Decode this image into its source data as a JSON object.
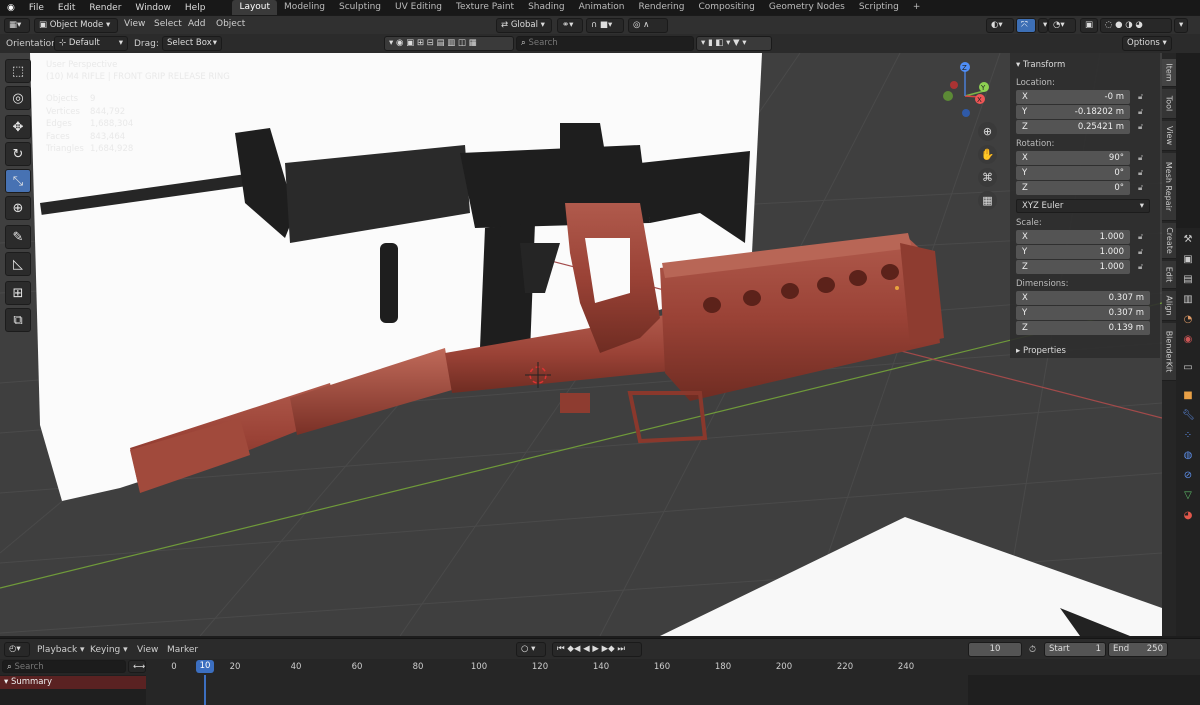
{
  "menu": [
    "File",
    "Edit",
    "Render",
    "Window",
    "Help"
  ],
  "workspaces": [
    "Layout",
    "Modeling",
    "Sculpting",
    "UV Editing",
    "Texture Paint",
    "Shading",
    "Animation",
    "Rendering",
    "Compositing",
    "Geometry Nodes",
    "Scripting"
  ],
  "header": {
    "mode": "Object Mode",
    "view": "View",
    "select": "Select",
    "add": "Add",
    "object": "Object",
    "transform_orientation": "Global",
    "options": "Options"
  },
  "tool_options": {
    "orientation_label": "Orientation:",
    "orientation_value": "Default",
    "drag_label": "Drag:",
    "drag_value": "Select Box",
    "search_placeholder": "Search"
  },
  "viewport": {
    "perspective": "User Perspective",
    "object_info": "(10) M4 RIFLE | FRONT GRIP RELEASE RING",
    "stats": [
      {
        "k": "Objects",
        "v": "9"
      },
      {
        "k": "Vertices",
        "v": "844,792"
      },
      {
        "k": "Edges",
        "v": "1,688,304"
      },
      {
        "k": "Faces",
        "v": "843,464"
      },
      {
        "k": "Triangles",
        "v": "1,684,928"
      }
    ],
    "gizmo": {
      "x": "X",
      "y": "Y",
      "z": "Z"
    }
  },
  "npanel": {
    "transform": "Transform",
    "location_label": "Location:",
    "location": [
      {
        "axis": "X",
        "value": "-0 m"
      },
      {
        "axis": "Y",
        "value": "-0.18202 m"
      },
      {
        "axis": "Z",
        "value": "0.25421 m"
      }
    ],
    "rotation_label": "Rotation:",
    "rotation": [
      {
        "axis": "X",
        "value": "90°"
      },
      {
        "axis": "Y",
        "value": "0°"
      },
      {
        "axis": "Z",
        "value": "0°"
      }
    ],
    "rotation_mode": "XYZ Euler",
    "scale_label": "Scale:",
    "scale": [
      {
        "axis": "X",
        "value": "1.000"
      },
      {
        "axis": "Y",
        "value": "1.000"
      },
      {
        "axis": "Z",
        "value": "1.000"
      }
    ],
    "dimensions_label": "Dimensions:",
    "dimensions": [
      {
        "axis": "X",
        "value": "0.307 m"
      },
      {
        "axis": "Y",
        "value": "0.307 m"
      },
      {
        "axis": "Z",
        "value": "0.139 m"
      }
    ],
    "properties": "Properties"
  },
  "side_tabs": [
    "Item",
    "Tool",
    "View",
    "Mesh Repair",
    "Create",
    "Edit",
    "Align",
    "BlenderKit"
  ],
  "timeline": {
    "playback": "Playback",
    "keying": "Keying",
    "view": "View",
    "marker": "Marker",
    "current_frame": "10",
    "start_label": "Start",
    "start": "1",
    "end_label": "End",
    "end": "250",
    "search_placeholder": "Search",
    "summary": "Summary",
    "ruler": [
      "0",
      "10",
      "20",
      "40",
      "60",
      "80",
      "100",
      "120",
      "140",
      "160",
      "180",
      "200",
      "220",
      "240"
    ]
  },
  "colors": {
    "accent": "#4772b3",
    "model_red": "#a0483c",
    "selection": "#e8a33d"
  }
}
